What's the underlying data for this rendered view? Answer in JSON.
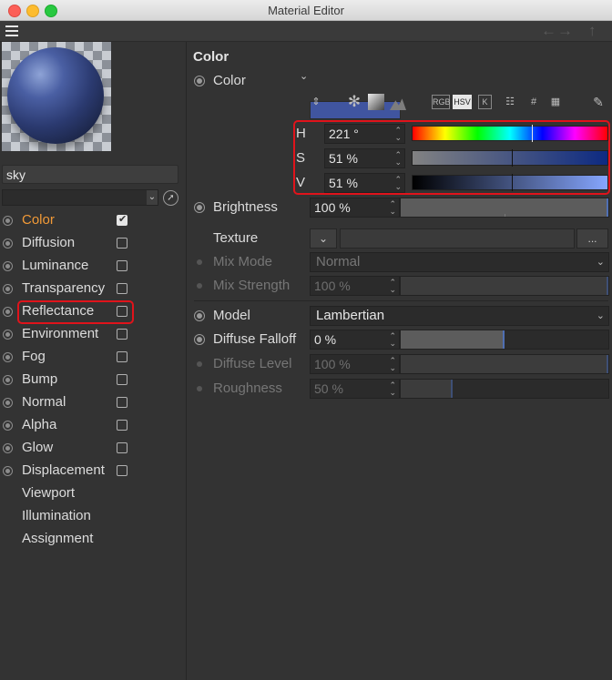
{
  "window": {
    "title": "Material Editor"
  },
  "toolbar": {
    "menu_icon": "hamburger-menu-icon",
    "back_icon": "arrow-left-icon",
    "forward_icon": "arrow-right-icon",
    "up_icon": "arrow-up-icon"
  },
  "material": {
    "name": "sky",
    "link_value": "",
    "preview_colors": {
      "sphere": "#3b4f96",
      "checker_light": "#c8ccd2",
      "checker_dark": "#8b9098"
    }
  },
  "channels": [
    {
      "label": "Color",
      "has_radio": true,
      "has_checkbox": true,
      "checked": true,
      "active": true
    },
    {
      "label": "Diffusion",
      "has_radio": true,
      "has_checkbox": true,
      "checked": false,
      "active": false
    },
    {
      "label": "Luminance",
      "has_radio": true,
      "has_checkbox": true,
      "checked": false,
      "active": false
    },
    {
      "label": "Transparency",
      "has_radio": true,
      "has_checkbox": true,
      "checked": false,
      "active": false
    },
    {
      "label": "Reflectance",
      "has_radio": true,
      "has_checkbox": true,
      "checked": false,
      "active": false
    },
    {
      "label": "Environment",
      "has_radio": true,
      "has_checkbox": true,
      "checked": false,
      "active": false
    },
    {
      "label": "Fog",
      "has_radio": true,
      "has_checkbox": true,
      "checked": false,
      "active": false
    },
    {
      "label": "Bump",
      "has_radio": true,
      "has_checkbox": true,
      "checked": false,
      "active": false
    },
    {
      "label": "Normal",
      "has_radio": true,
      "has_checkbox": true,
      "checked": false,
      "active": false
    },
    {
      "label": "Alpha",
      "has_radio": true,
      "has_checkbox": true,
      "checked": false,
      "active": false
    },
    {
      "label": "Glow",
      "has_radio": true,
      "has_checkbox": true,
      "checked": false,
      "active": false
    },
    {
      "label": "Displacement",
      "has_radio": true,
      "has_checkbox": true,
      "checked": false,
      "active": false
    },
    {
      "label": "Viewport",
      "has_radio": false,
      "has_checkbox": false,
      "checked": false,
      "active": false
    },
    {
      "label": "Illumination",
      "has_radio": false,
      "has_checkbox": false,
      "checked": false,
      "active": false
    },
    {
      "label": "Assignment",
      "has_radio": false,
      "has_checkbox": false,
      "checked": false,
      "active": false
    }
  ],
  "panel": {
    "section_title": "Color",
    "color": {
      "label": "Color",
      "swatch": "#4055a0"
    },
    "color_modes": [
      "RGB",
      "HSV",
      "K"
    ],
    "active_color_mode": "HSV",
    "hsv": {
      "h": {
        "label": "H",
        "value": "221 °",
        "fraction": 0.614
      },
      "s": {
        "label": "S",
        "value": "51 %",
        "fraction": 0.51
      },
      "v": {
        "label": "V",
        "value": "51 %",
        "fraction": 0.51
      }
    },
    "brightness": {
      "label": "Brightness",
      "value": "100 %",
      "fraction": 1.0
    },
    "texture": {
      "label": "Texture",
      "more": "..."
    },
    "mix_mode": {
      "label": "Mix Mode",
      "value": "Normal"
    },
    "mix_strength": {
      "label": "Mix Strength",
      "value": "100 %",
      "fraction": 1.0
    },
    "model": {
      "label": "Model",
      "value": "Lambertian"
    },
    "diffuse_falloff": {
      "label": "Diffuse Falloff",
      "value": "0 %",
      "fraction": 0.5
    },
    "diffuse_level": {
      "label": "Diffuse Level",
      "value": "100 %",
      "fraction": 1.0
    },
    "roughness": {
      "label": "Roughness",
      "value": "50 %",
      "fraction": 0.25
    }
  },
  "colors": {
    "accent_orange": "#f29a37",
    "highlight_red": "#e0131b",
    "slider_marker": "#4f6fb3"
  }
}
